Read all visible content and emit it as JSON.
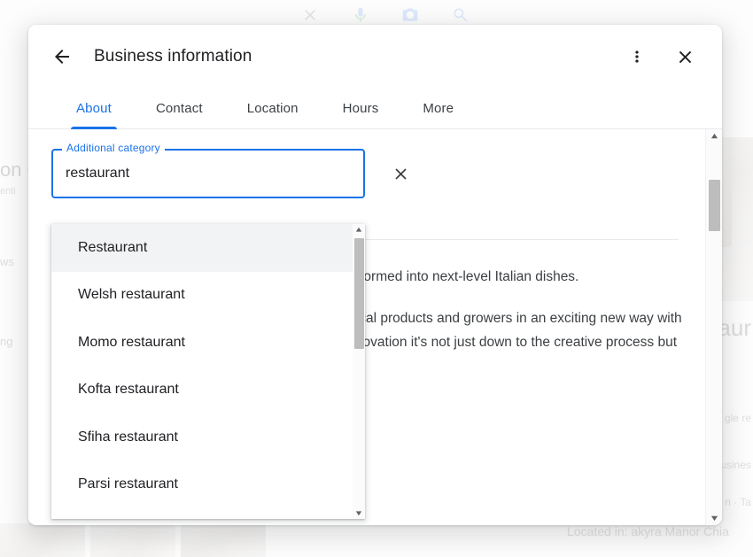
{
  "background": {
    "search_icons": [
      "close-icon",
      "microphone-icon",
      "camera-icon",
      "search-icon"
    ],
    "left_title": "on C",
    "left_sub": "enti",
    "left_reviews": "ws",
    "left_ing": "ng",
    "right_title": "aur",
    "right_line1": "gle re",
    "right_line2": "usines",
    "right_line3": "n · Ta",
    "located_in": "Located in: akyra Manor Chia"
  },
  "dialog": {
    "title": "Business information",
    "back_icon": "back-arrow-icon",
    "menu_icon": "more-vert-icon",
    "close_icon": "close-icon",
    "tabs": [
      {
        "label": "About",
        "active": true
      },
      {
        "label": "Contact",
        "active": false
      },
      {
        "label": "Location",
        "active": false
      },
      {
        "label": "Hours",
        "active": false
      },
      {
        "label": "More",
        "active": false
      }
    ],
    "field": {
      "legend": "Additional category",
      "value": "restaurant",
      "placeholder": "Additional category",
      "clear_icon": "close-icon"
    },
    "content": {
      "paragraph_1": "A seasonal menu with local ingredients being transformed into next-level Italian dishes.",
      "paragraph_2": "Innovative and contemporary Italian showcasing local products and growers in an exciting new way with the culinary philosophy well-shaped. In terms of innovation it's not just down to the creative process but to carefully hand picking the finest"
    },
    "scrollbar": {
      "up_icon": "scroll-up-arrow-icon",
      "down_icon": "scroll-down-arrow-icon"
    }
  },
  "autocomplete": {
    "options": [
      {
        "label": "Restaurant",
        "highlighted": true
      },
      {
        "label": "Welsh restaurant",
        "highlighted": false
      },
      {
        "label": "Momo restaurant",
        "highlighted": false
      },
      {
        "label": "Kofta restaurant",
        "highlighted": false
      },
      {
        "label": "Sfiha restaurant",
        "highlighted": false
      },
      {
        "label": "Parsi restaurant",
        "highlighted": false
      }
    ],
    "scrollbar": {
      "up_icon": "scroll-up-arrow-icon",
      "down_icon": "scroll-down-arrow-icon"
    }
  },
  "colors": {
    "accent": "#1a73e8",
    "text_primary": "#202124",
    "text_secondary": "#3c4043",
    "divider": "#e8eaed",
    "highlight": "#f1f3f4"
  }
}
